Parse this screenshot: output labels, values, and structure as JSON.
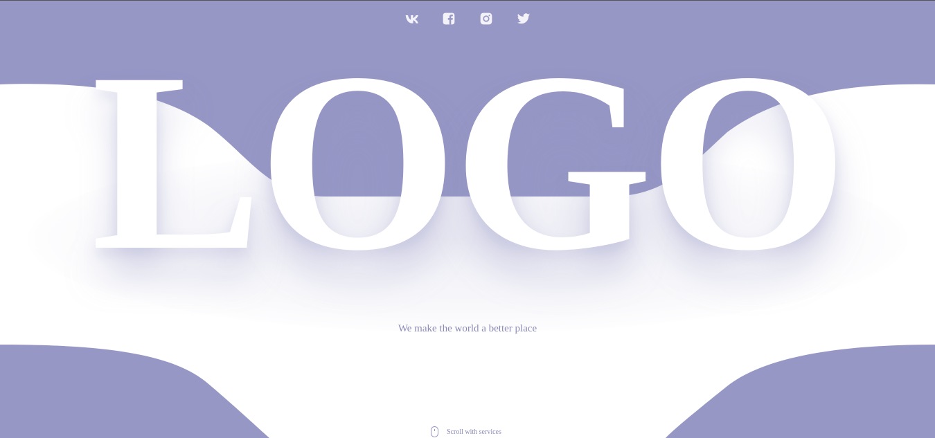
{
  "hero": {
    "logo_text": "LOGO",
    "tagline": "We make the world a better place",
    "scroll_label": "Scroll with services"
  },
  "social": [
    {
      "name": "vk-icon",
      "label": "VK"
    },
    {
      "name": "facebook-icon",
      "label": "Facebook"
    },
    {
      "name": "instagram-icon",
      "label": "Instagram"
    },
    {
      "name": "twitter-icon",
      "label": "Twitter"
    }
  ],
  "colors": {
    "accent": "#9797c6",
    "text": "#8a8ab8",
    "background": "#ffffff",
    "icon": "#f2f2f8"
  }
}
